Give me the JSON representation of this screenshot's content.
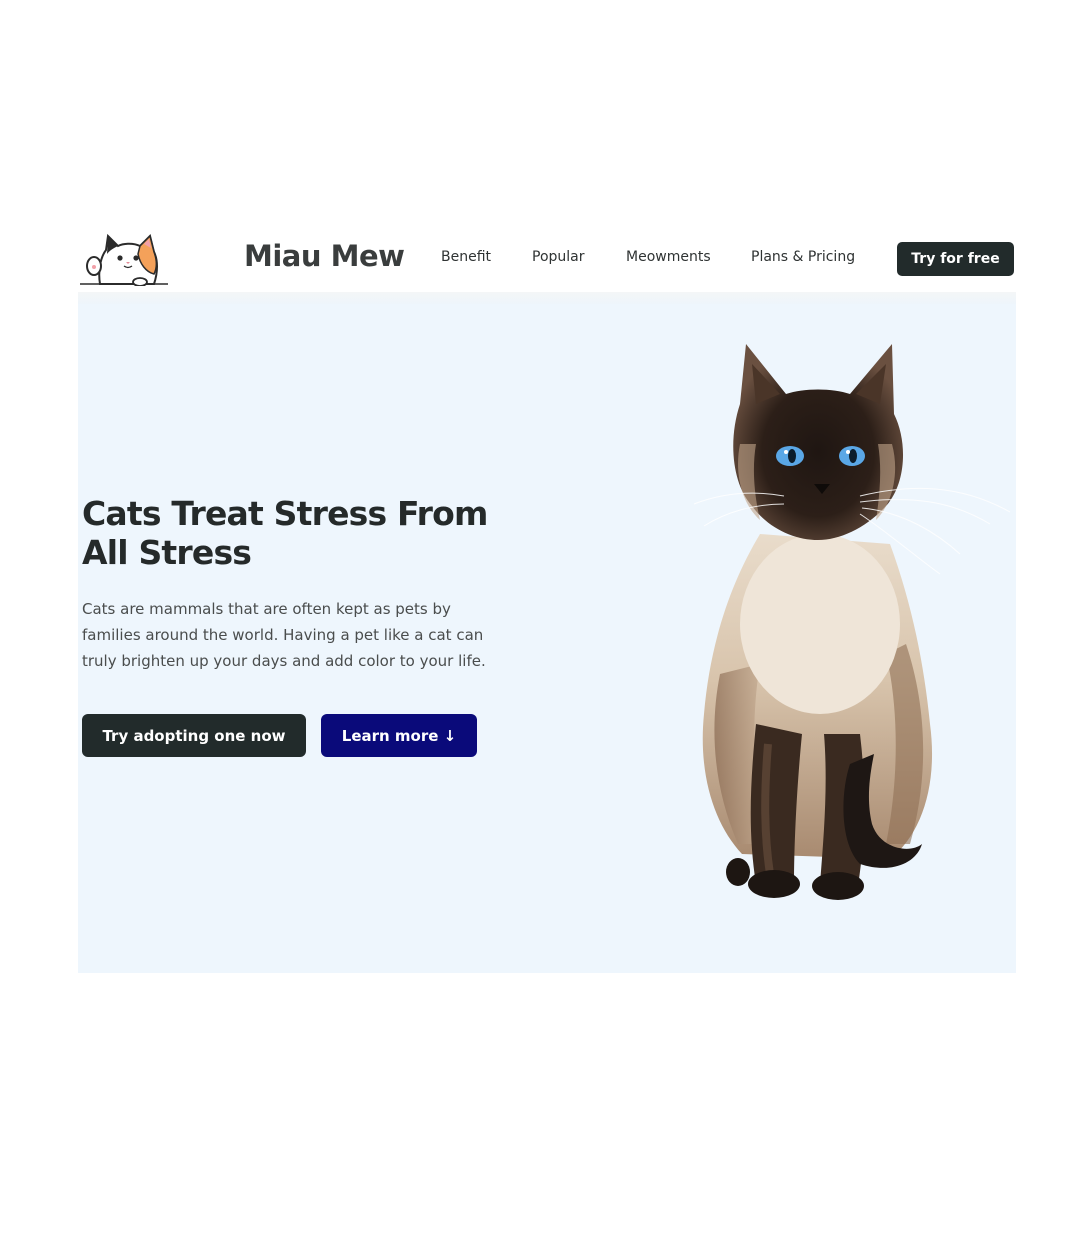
{
  "nav": {
    "brand": "Miau Mew",
    "links": [
      "Benefit",
      "Popular",
      "Meowments",
      "Plans & Pricing"
    ],
    "cta": "Try for free"
  },
  "hero": {
    "title": "Cats Treat Stress From All Stress",
    "description": "Cats are mammals that are often kept as pets by families around the world. Having a pet like a cat can truly brighten up your days and add color to your life.",
    "primary_button": "Try adopting one now",
    "secondary_button": "Learn more ↓"
  },
  "colors": {
    "dark": "#222b2b",
    "accent": "#0a0a7a",
    "hero_bg": "#eef6fd"
  },
  "icons": {
    "logo": "calico-cat-waving-icon",
    "hero_image": "siamese-cat-photo"
  }
}
